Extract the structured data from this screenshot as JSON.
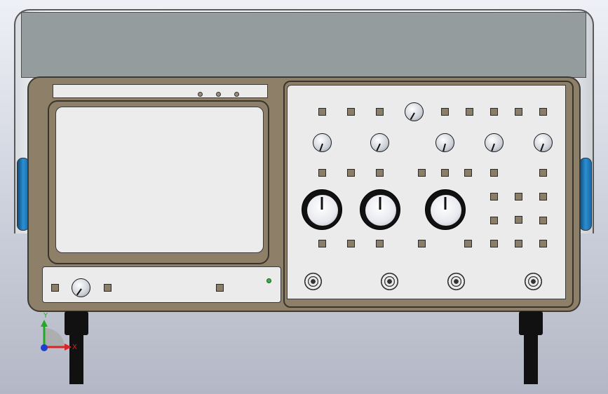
{
  "colors": {
    "body": "#8e8068",
    "panel": "#ebebeb",
    "top_cover": "#959c9e",
    "side_cap": "#2b8fd2",
    "led": "#36b24a"
  },
  "axes_triad": {
    "y_label": "Y",
    "x_label": "X"
  }
}
